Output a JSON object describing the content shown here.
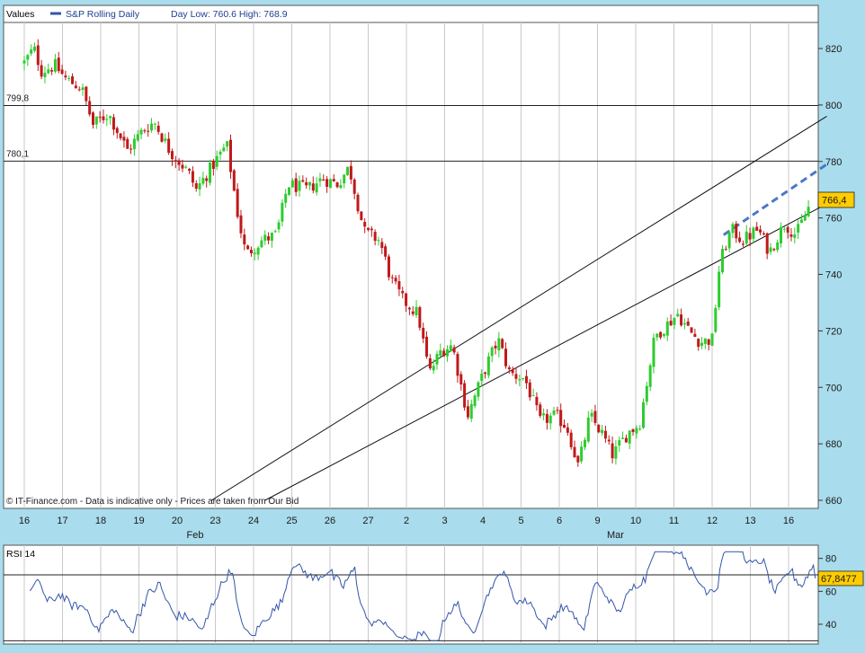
{
  "header": {
    "values_label": "Values",
    "series_name": "S&P Rolling Daily",
    "day_range": "Day Low: 760.6 High: 768.9"
  },
  "footer_note": "© IT-Finance.com - Data is indicative only - Prices are taken from Our Bid",
  "colors": {
    "up": "#2ecc2e",
    "down": "#c0191b",
    "rsi_line": "#3355aa",
    "dashed_trend": "#4a78c8",
    "price_tag": "#ffcc00"
  },
  "chart_data": [
    {
      "type": "candlestick",
      "title": "S&P Rolling Daily",
      "ylim": [
        660,
        830
      ],
      "y_ticks": [
        660,
        680,
        700,
        720,
        740,
        760,
        780,
        800,
        820
      ],
      "x_tick_labels": [
        "16",
        "17",
        "18",
        "19",
        "20",
        "23",
        "24",
        "25",
        "26",
        "27",
        "2",
        "3",
        "4",
        "5",
        "6",
        "9",
        "10",
        "11",
        "12",
        "13",
        "16"
      ],
      "month_labels": [
        {
          "label": "Feb",
          "at_tick": "20"
        },
        {
          "label": "Mar",
          "at_tick": "9"
        }
      ],
      "horizontal_levels": [
        {
          "label": "799,8",
          "value": 799.8
        },
        {
          "label": "780,1",
          "value": 780.1
        }
      ],
      "last_price_label": "766,4",
      "last_price": 766.4,
      "trend_channel": {
        "upper": [
          {
            "day": 4.9,
            "value": 660
          },
          {
            "day": 21,
            "value": 796
          }
        ],
        "lower": [
          {
            "day": 6.3,
            "value": 660
          },
          {
            "day": 21,
            "value": 765
          }
        ],
        "dashed": [
          {
            "day": 18.3,
            "value": 754
          },
          {
            "day": 21,
            "value": 779
          }
        ]
      },
      "path_keypoints": [
        [
          0,
          815
        ],
        [
          0.25,
          820
        ],
        [
          0.45,
          812
        ],
        [
          0.8,
          814
        ],
        [
          1.1,
          809
        ],
        [
          1.5,
          806
        ],
        [
          1.8,
          793
        ],
        [
          2.2,
          797
        ],
        [
          2.7,
          784
        ],
        [
          3.1,
          791
        ],
        [
          3.4,
          794
        ],
        [
          3.8,
          784
        ],
        [
          4.3,
          776
        ],
        [
          4.5,
          770
        ],
        [
          5.0,
          780
        ],
        [
          5.3,
          786
        ],
        [
          5.6,
          760
        ],
        [
          5.8,
          747
        ],
        [
          6.2,
          752
        ],
        [
          6.6,
          754
        ],
        [
          6.9,
          772
        ],
        [
          7.4,
          770
        ],
        [
          7.8,
          774
        ],
        [
          8.2,
          772
        ],
        [
          8.5,
          778
        ],
        [
          8.9,
          755
        ],
        [
          9.3,
          752
        ],
        [
          9.6,
          738
        ],
        [
          9.9,
          731
        ],
        [
          10.3,
          726
        ],
        [
          10.6,
          705
        ],
        [
          10.9,
          713
        ],
        [
          11.2,
          715
        ],
        [
          11.6,
          690
        ],
        [
          12.1,
          708
        ],
        [
          12.4,
          717
        ],
        [
          12.7,
          705
        ],
        [
          13.1,
          703
        ],
        [
          13.5,
          688
        ],
        [
          13.9,
          690
        ],
        [
          14.2,
          686
        ],
        [
          14.5,
          672
        ],
        [
          14.8,
          690
        ],
        [
          15.1,
          684
        ],
        [
          15.4,
          676
        ],
        [
          15.8,
          684
        ],
        [
          16.1,
          687
        ],
        [
          16.5,
          718
        ],
        [
          16.8,
          722
        ],
        [
          17.1,
          726
        ],
        [
          17.4,
          720
        ],
        [
          17.7,
          716
        ],
        [
          18.0,
          717
        ],
        [
          18.2,
          744
        ],
        [
          18.5,
          756
        ],
        [
          18.8,
          752
        ],
        [
          19.2,
          756
        ],
        [
          19.5,
          748
        ],
        [
          19.9,
          758
        ],
        [
          20.2,
          754
        ],
        [
          20.6,
          766
        ]
      ]
    },
    {
      "type": "line",
      "title": "RSI 14",
      "ylim": [
        28,
        88
      ],
      "y_ticks": [
        40,
        60,
        80
      ],
      "horizontal_levels": [
        70,
        30
      ],
      "last_value_label": "67,8477",
      "last_value": 67.8477
    }
  ]
}
